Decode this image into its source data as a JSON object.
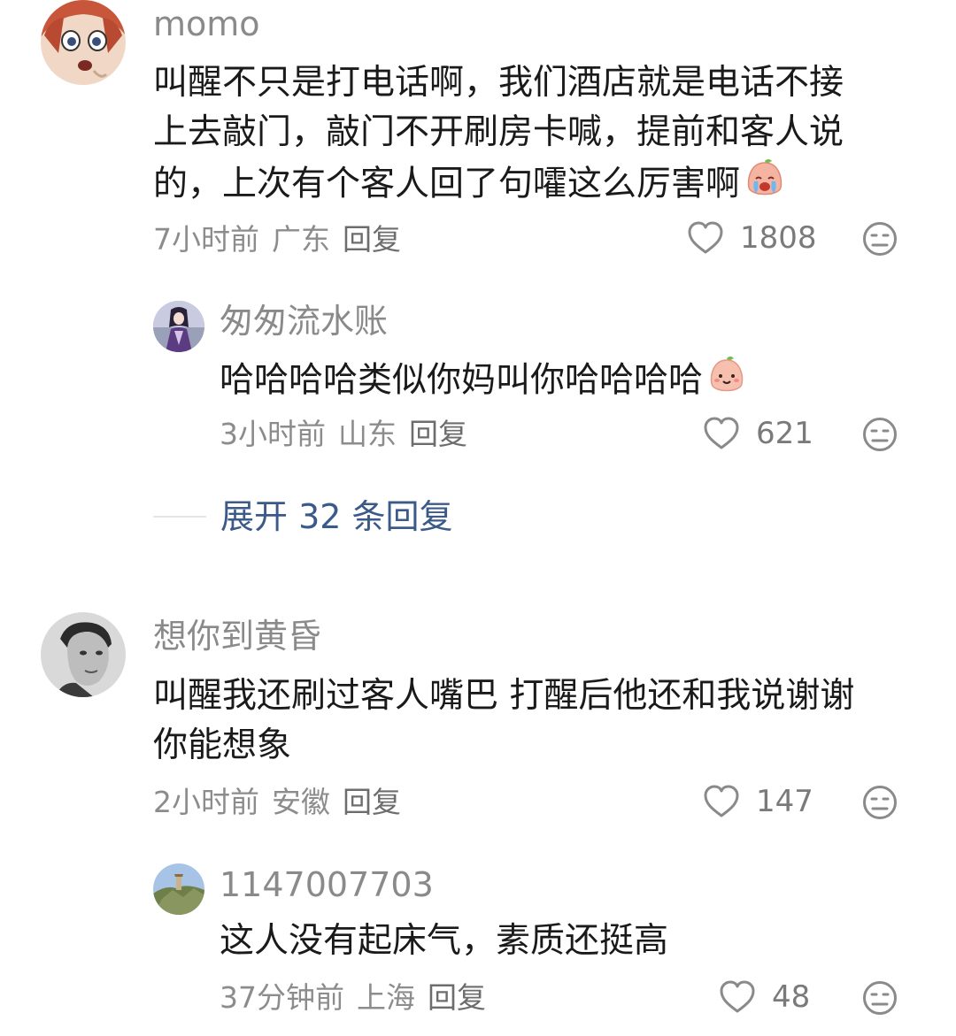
{
  "comments": [
    {
      "username": "momo",
      "text_lines": [
        "叫醒不只是打电话啊，我们酒店就是电话不接",
        "上去敲门，敲门不开刷房卡喊，提前和客人说",
        "的，上次有个客人回了句嚯这么厉害啊"
      ],
      "emoji": "crying-emoji",
      "time": "7小时前",
      "location": "广东",
      "reply_label": "回复",
      "likes": "1808",
      "replies": [
        {
          "username": "匆匆流水账",
          "text": "哈哈哈哈类似你妈叫你哈哈哈哈",
          "emoji": "smiling-emoji",
          "time": "3小时前",
          "location": "山东",
          "reply_label": "回复",
          "likes": "621"
        }
      ],
      "expand_label": "展开 32 条回复"
    },
    {
      "username": "想你到黄昏",
      "text_lines": [
        "叫醒我还刷过客人嘴巴 打醒后他还和我说谢谢",
        "你能想象"
      ],
      "time": "2小时前",
      "location": "安徽",
      "reply_label": "回复",
      "likes": "147",
      "replies": [
        {
          "username": "1147007703",
          "text": "这人没有起床气，素质还挺高",
          "time": "37分钟前",
          "location": "上海",
          "reply_label": "回复",
          "likes": "48"
        }
      ]
    }
  ],
  "icons": {
    "like": "heart-outline-icon",
    "dislike": "neutral-face-icon"
  },
  "colors": {
    "link": "#3b5a8a",
    "meta": "#8c8c8c"
  }
}
